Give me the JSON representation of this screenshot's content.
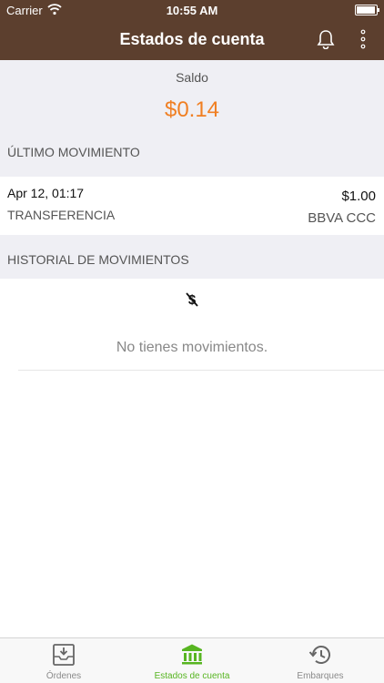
{
  "status_bar": {
    "carrier": "Carrier",
    "time": "10:55 AM",
    "battery_level": 0.95
  },
  "nav": {
    "title": "Estados de cuenta",
    "bell_icon": "bell-icon",
    "more_icon": "more-vertical-icon"
  },
  "balance": {
    "label": "Saldo",
    "amount": "$0.14",
    "amount_color": "#f07f22"
  },
  "last_movement": {
    "header": "ÚLTIMO MOVIMIENTO",
    "date": "Apr 12, 01:17",
    "type": "TRANSFERENCIA",
    "amount": "$1.00",
    "bank": "BBVA CCC"
  },
  "history": {
    "header": "HISTORIAL DE MOVIMIENTOS",
    "empty_icon": "no-money-icon",
    "empty_message": "No tienes movimientos."
  },
  "tabs": [
    {
      "label": "Órdenes",
      "icon": "inbox-download-icon",
      "active": false
    },
    {
      "label": "Estados de cuenta",
      "icon": "bank-icon",
      "active": true
    },
    {
      "label": "Embarques",
      "icon": "history-icon",
      "active": false
    }
  ],
  "colors": {
    "brand": "#5c3f2e",
    "accent": "#f07f22",
    "active_tab": "#57b521",
    "background": "#efeff4"
  }
}
